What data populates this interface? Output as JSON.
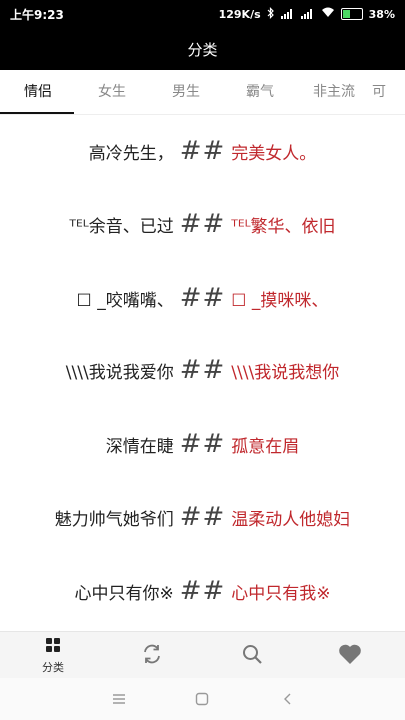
{
  "status": {
    "time": "上午9:23",
    "network_speed": "129K/s",
    "battery_pct": "38%"
  },
  "header": {
    "title": "分类"
  },
  "tabs": [
    {
      "label": "情侣",
      "active": true
    },
    {
      "label": "女生"
    },
    {
      "label": "男生"
    },
    {
      "label": "霸气"
    },
    {
      "label": "非主流"
    },
    {
      "label": "可"
    }
  ],
  "pairs": [
    {
      "left": "高冷先生，",
      "sep": "##",
      "right": "完美女人。"
    },
    {
      "left": "ᵀᴱᴸ余音、已过",
      "sep": "##",
      "right": "ᵀᴱᴸ繁华、依旧"
    },
    {
      "left": "☐ _咬嘴嘴、",
      "sep": "##",
      "right": "☐ _摸咪咪、"
    },
    {
      "left": "\\\\\\\\我说我爱你",
      "sep": "##",
      "right": "\\\\\\\\我说我想你"
    },
    {
      "left": "深情在睫",
      "sep": "##",
      "right": "孤意在眉"
    },
    {
      "left": "魅力帅气她爷们",
      "sep": "##",
      "right": "温柔动人他媳妇"
    },
    {
      "left": "心中只有你※",
      "sep": "##",
      "right": "心中只有我※"
    }
  ],
  "bottom_nav": {
    "category_label": "分类",
    "icons": [
      "grid-icon",
      "refresh-icon",
      "search-icon",
      "heart-icon"
    ]
  },
  "colors": {
    "accent_red": "#c0282d",
    "bar_black": "#000000"
  }
}
